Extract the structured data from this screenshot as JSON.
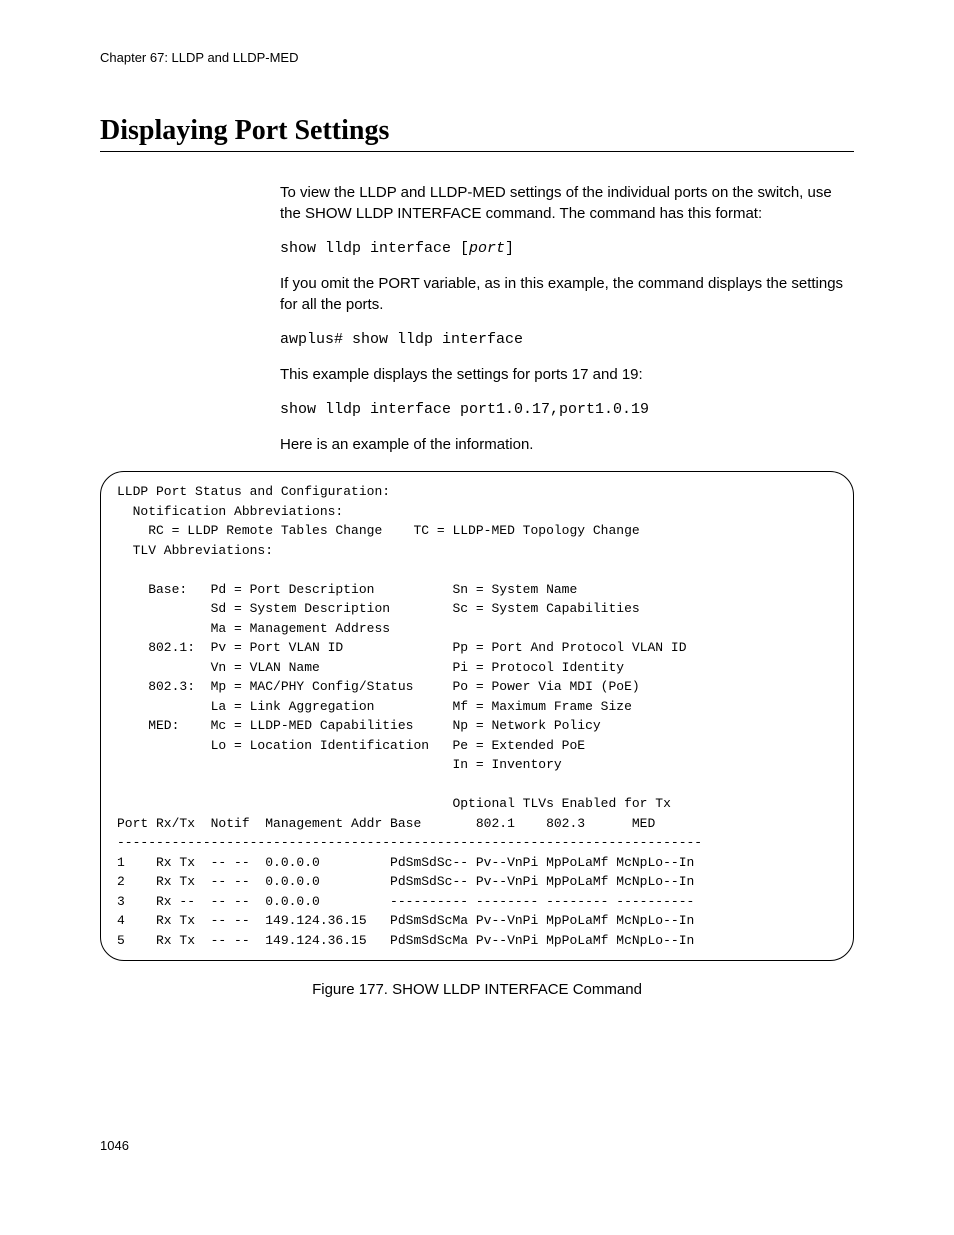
{
  "chapter_header": "Chapter 67: LLDP and LLDP-MED",
  "section_title": "Displaying Port Settings",
  "intro_para": "To view the LLDP and LLDP-MED settings of the individual ports on the switch, use the SHOW LLDP INTERFACE command. The command has this format:",
  "cmd_syntax_pre": "show lldp interface [",
  "cmd_syntax_var": "port",
  "cmd_syntax_post": "]",
  "omit_para": "If you omit the PORT variable, as in this example, the command displays the settings for all the ports.",
  "cmd_example1": "awplus# show lldp interface",
  "example_ports_para": "This example displays the settings for ports 17 and 19:",
  "cmd_example2": "show lldp interface port1.0.17,port1.0.19",
  "here_para": "Here is an example of the information.",
  "output_text": "LLDP Port Status and Configuration:\n  Notification Abbreviations:\n    RC = LLDP Remote Tables Change    TC = LLDP-MED Topology Change\n  TLV Abbreviations:\n\n    Base:   Pd = Port Description          Sn = System Name\n            Sd = System Description        Sc = System Capabilities\n            Ma = Management Address\n    802.1:  Pv = Port VLAN ID              Pp = Port And Protocol VLAN ID\n            Vn = VLAN Name                 Pi = Protocol Identity\n    802.3:  Mp = MAC/PHY Config/Status     Po = Power Via MDI (PoE)\n            La = Link Aggregation          Mf = Maximum Frame Size\n    MED:    Mc = LLDP-MED Capabilities     Np = Network Policy\n            Lo = Location Identification   Pe = Extended PoE\n                                           In = Inventory\n\n                                           Optional TLVs Enabled for Tx\nPort Rx/Tx  Notif  Management Addr Base       802.1    802.3      MED\n---------------------------------------------------------------------------\n1    Rx Tx  -- --  0.0.0.0         PdSmSdSc-- Pv--VnPi MpPoLaMf McNpLo--In\n2    Rx Tx  -- --  0.0.0.0         PdSmSdSc-- Pv--VnPi MpPoLaMf McNpLo--In\n3    Rx --  -- --  0.0.0.0         ---------- -------- -------- ----------\n4    Rx Tx  -- --  149.124.36.15   PdSmSdScMa Pv--VnPi MpPoLaMf McNpLo--In\n5    Rx Tx  -- --  149.124.36.15   PdSmSdScMa Pv--VnPi MpPoLaMf McNpLo--In",
  "figure_caption": "Figure 177. SHOW LLDP INTERFACE Command",
  "page_number": "1046"
}
